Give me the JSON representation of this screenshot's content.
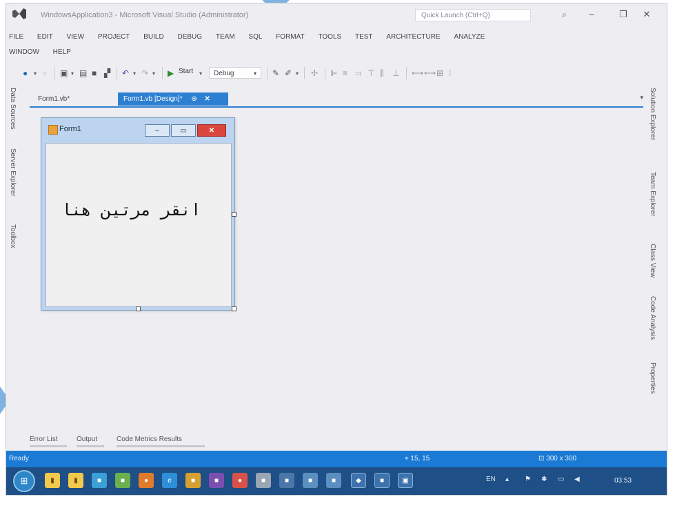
{
  "window": {
    "title": "WindowsApplication3 - Microsoft Visual Studio (Administrator)",
    "quick_launch_placeholder": "Quick Launch (Ctrl+Q)",
    "controls": [
      "⌕",
      "–",
      "❐",
      "✕"
    ]
  },
  "menu": {
    "items": [
      "FILE",
      "EDIT",
      "VIEW",
      "PROJECT",
      "BUILD",
      "DEBUG",
      "TEAM",
      "SQL",
      "FORMAT",
      "TOOLS",
      "TEST",
      "ARCHITECTURE",
      "ANALYZE"
    ],
    "items_row2": [
      "WINDOW",
      "HELP"
    ]
  },
  "toolbar": {
    "start_label": "Start",
    "config_value": "Debug"
  },
  "left_rail": [
    "Data Sources",
    "Server Explorer",
    "Toolbox"
  ],
  "right_rail": [
    "Solution Explorer",
    "Team Explorer",
    "Class View",
    "Code Analysis",
    "Properties"
  ],
  "tabs": {
    "items": [
      {
        "label": "Form1.vb*"
      },
      {
        "label": "Form1.vb [Design]*"
      }
    ]
  },
  "form": {
    "title": "Form1",
    "label_text": "انقر مرتين هنا"
  },
  "bottom_tabs": [
    "Error List",
    "Output",
    "Code Metrics Results"
  ],
  "status": {
    "ready": "Ready",
    "position": "15, 15",
    "size": "300 x 300"
  },
  "taskbar": {
    "language": "EN",
    "time": "03:53"
  },
  "colors": {
    "accent": "#2d7fd1",
    "statusbar": "#1a7ad4",
    "taskbar": "#1e4f86"
  }
}
